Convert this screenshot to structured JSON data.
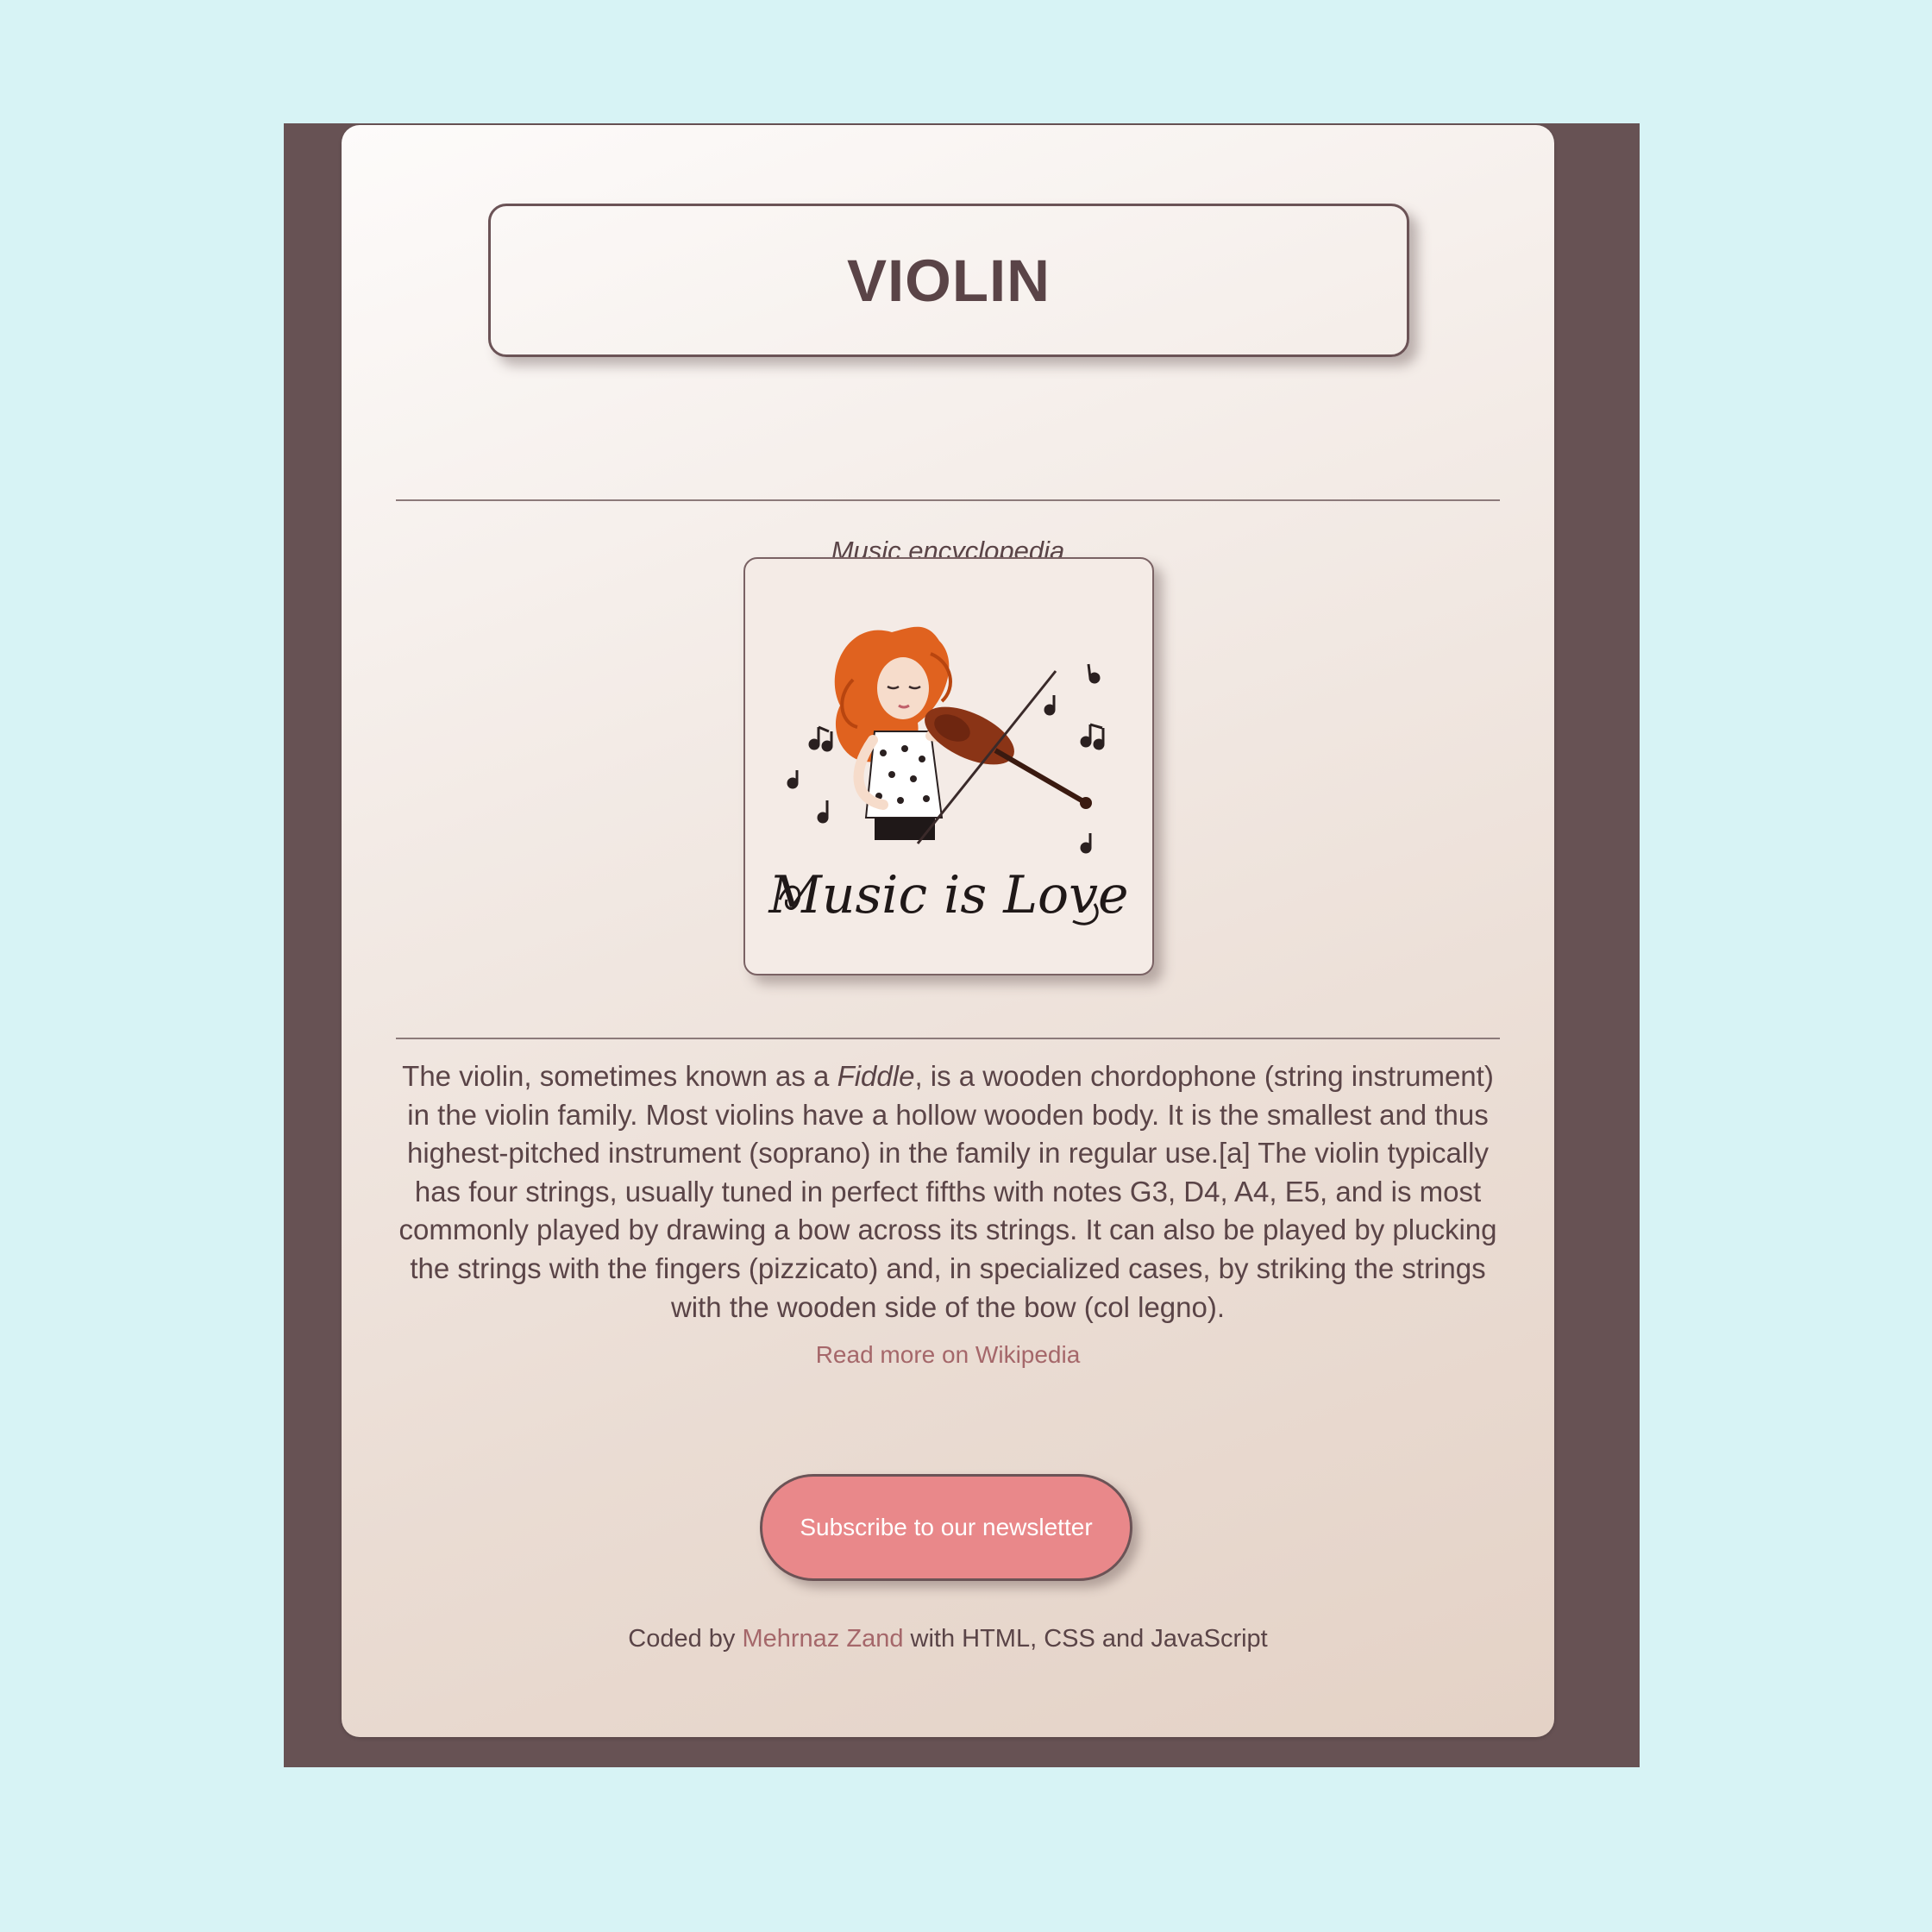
{
  "page": {
    "title": "VIOLIN",
    "subtitle": "Music encyclopedia"
  },
  "image": {
    "alt": "Music is Love",
    "caption_art": "Music is Love"
  },
  "description": {
    "part1": "The violin, sometimes known as a ",
    "emphasis": "Fiddle",
    "part2": ", is a wooden chordophone (string instrument) in the violin family. Most violins have a hollow wooden body. It is the smallest and thus highest-pitched instrument (soprano) in the family in regular use.[a] The violin typically has four strings, usually tuned in perfect fifths with notes G3, D4, A4, E5, and is most commonly played by drawing a bow across its strings. It can also be played by plucking the strings with the fingers (pizzicato) and, in specialized cases, by striking the strings with the wooden side of the bow (col legno)."
  },
  "links": {
    "read_more": "Read more on Wikipedia"
  },
  "subscribe": {
    "label": "Subscribe to our newsletter"
  },
  "footer": {
    "prefix": "Coded by ",
    "author": "Mehrnaz Zand",
    "suffix": " with HTML, CSS and JavaScript"
  },
  "colors": {
    "background": "#d7f3f5",
    "frame": "#675254",
    "text": "#5a4447",
    "link": "#a5676a",
    "button": "#e9888a"
  }
}
